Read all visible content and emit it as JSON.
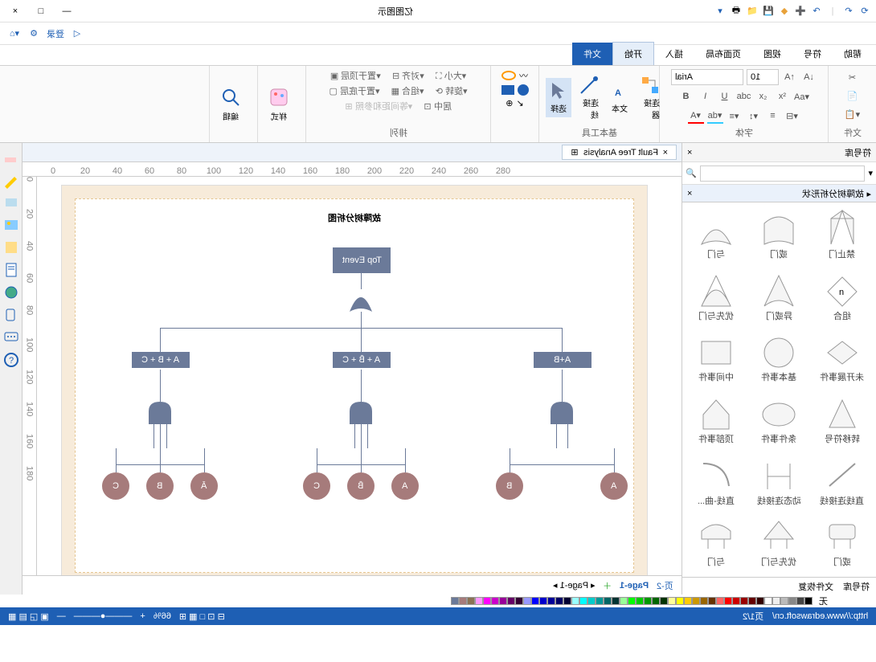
{
  "title": "亿图图示",
  "tabs": [
    "文件",
    "开始",
    "插入",
    "页面布局",
    "视图",
    "符号",
    "帮助"
  ],
  "activeTab": 1,
  "qat_login": "登录",
  "ribbon": {
    "file_group": "文件",
    "font_group": "字体",
    "tool_group": "基本工具",
    "arrange_group": "排列",
    "edit_group": "编辑",
    "font_name": "Arial",
    "font_size": "10",
    "select": "选择",
    "connector": "连接线",
    "text": "文本",
    "connect": "连接器",
    "align_top": "置于顶层",
    "align_bot": "置于底层",
    "align": "对齐",
    "group": "组合",
    "size": "大小",
    "rotate": "旋转",
    "center": "居中",
    "space": "等间距和参照"
  },
  "shapes": {
    "title": "符号库",
    "category": "故障树分析形状",
    "items": [
      "与门",
      "或门",
      "禁止门",
      "优先与门",
      "异或门",
      "组合",
      "中间事件",
      "基本事件",
      "未开展事件",
      "顶部事件",
      "条件事件",
      "转移符号",
      "直线-曲...",
      "动态连接线",
      "直线连接线",
      "与门",
      "优先与门",
      "或门"
    ],
    "footer_left": "文件恢复",
    "footer_right": "符号库"
  },
  "doc_tab": "Fault Tree Analysis",
  "diagram": {
    "title": "故障树分析图",
    "top": "Top Event",
    "l1": [
      "A + B + C",
      "A + B̄ + C",
      "A+B"
    ],
    "leaves": [
      [
        "C",
        "B",
        "Ā"
      ],
      [
        "C",
        "B̄",
        "A"
      ],
      [
        "B",
        "A"
      ]
    ]
  },
  "pages": {
    "p1": "Page-1",
    "p2": "页-2",
    "nav": "◂ Page-1 ▸"
  },
  "status": {
    "url": "http://www.edrawsoft.cn/",
    "pg": "页1/2",
    "zoom": "66%",
    "none": "无"
  }
}
